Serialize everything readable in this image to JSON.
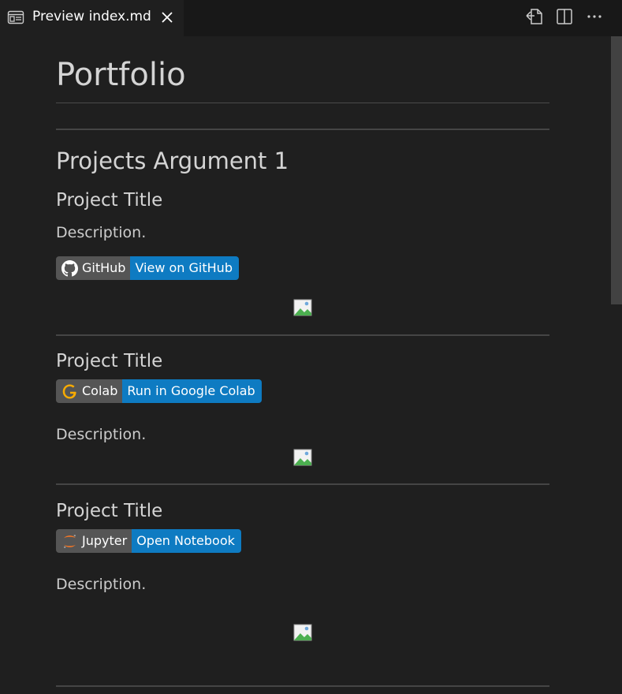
{
  "tab": {
    "title": "Preview index.md",
    "icon": "preview-icon",
    "close_icon": "close-icon"
  },
  "actions": [
    {
      "name": "open-source-icon"
    },
    {
      "name": "split-editor-icon"
    },
    {
      "name": "more-actions-icon"
    }
  ],
  "document": {
    "title": "Portfolio",
    "section_title": "Projects Argument 1",
    "projects": [
      {
        "title": "Project Title",
        "description": "Description.",
        "badge_left": "GitHub",
        "badge_right": "View on GitHub",
        "badge_icon": "github-icon"
      },
      {
        "title": "Project Title",
        "description": "Description.",
        "badge_left": "Colab",
        "badge_right": "Run in Google Colab",
        "badge_icon": "google-icon"
      },
      {
        "title": "Project Title",
        "description": "Description.",
        "badge_left": "Jupyter",
        "badge_right": "Open Notebook",
        "badge_icon": "jupyter-icon"
      }
    ]
  },
  "colors": {
    "badge_label_bg": "#555555",
    "badge_value_bg": "#0e7bc2",
    "background": "#1f1f1f"
  }
}
